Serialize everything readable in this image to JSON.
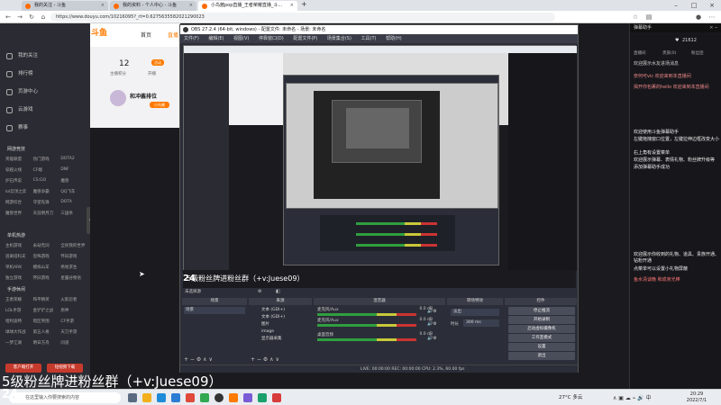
{
  "browser": {
    "tabs": [
      {
        "label": "我的关注 - 斗鱼"
      },
      {
        "label": "我的资料 - 个人中心 - 斗鱼"
      },
      {
        "label": "小鸟酱pop直播_王者荣耀直播_斗..."
      }
    ],
    "url": "https://www.douyu.com/10216095?_rt=0.6275635582021290023"
  },
  "douyu": {
    "logo": "斗鱼",
    "header_nav": [
      "首页",
      "直播"
    ],
    "left_nav": [
      {
        "label": "我的关注"
      },
      {
        "label": "排行榜"
      },
      {
        "label": "页游中心"
      },
      {
        "label": "云游戏"
      },
      {
        "label": "赛事"
      }
    ],
    "section_online": "网游竞技",
    "online_games": [
      "英雄联盟",
      "热门游戏",
      "DOTA2",
      "穿越火线",
      "CF端",
      "DNF",
      "炉石传说",
      "CS:GO",
      "魔兽",
      "lol云顶之弈",
      "魔兽争霸",
      "QQ飞车",
      "网游综合",
      "守望先锋",
      "DOTA",
      "魔兽世界",
      "天涯明月刀",
      "三国杀"
    ],
    "section_mobile": "单机热游",
    "mobile_games": [
      "主机游戏",
      "永劫无间",
      "全民我的世界",
      "逃离塔科夫",
      "恐怖游戏",
      "怀旧游戏",
      "单机ARK",
      "模拟山羊",
      "绝地求生",
      "独立游戏",
      "怀旧游戏",
      "星露谷物语"
    ],
    "section_hand": "手游休闲",
    "hand_games": [
      "王者荣耀",
      "和平精英",
      "火影忍者",
      "LOL手游",
      "金铲铲之战",
      "原神",
      "哈利波特",
      "暗区突围",
      "CF手游",
      "球球大作战",
      "第五人格",
      "天刀手游",
      "一梦江湖",
      "明日方舟",
      "问道"
    ],
    "stat_value": "12",
    "stat_label": "主播积分",
    "stat_label2": "开播",
    "badge": "活动",
    "room_title": "和冲酱排位",
    "room_sub": "小鸟酱",
    "left_buttons": [
      "客户端打开",
      "短视频下载"
    ],
    "overlay_text": "5级粉丝牌进粉丝群（+v:Juese09）",
    "overlay_prefix": "24"
  },
  "chat": {
    "title": "弹幕助手",
    "count": "21612",
    "tabs": [
      "直播间",
      "贵族(0)",
      "粉丝团"
    ],
    "lines": [
      "欢迎展示水友进场消息",
      "奈何可vic 欢迎来到本直播间",
      "揭开你包裹的hello 欢迎来到本直播间",
      "欢迎使用斗鱼弹幕助手",
      "左键拖拽窗口位置，左键拉伸边框改变大小",
      "右上角有设置菜单",
      "欢迎展示弹幕、表情礼物、粉丝牌升级等",
      "添加弹幕助手成功",
      "欢迎展示你收到的礼物、道具、贵族开通、钻粉开通",
      "点菜单可以设置小礼物屏蔽",
      "鱼水清谈晚 和成亲光棒"
    ]
  },
  "obs": {
    "title": "OBS 27.2.4 (64-bit, windows) - 配置文件: 未命名 - 场景: 未命名",
    "menu": [
      "文件(F)",
      "编辑(E)",
      "视图(V)",
      "停靠窗口(D)",
      "配置文件(P)",
      "场景集合(S)",
      "工具(T)",
      "帮助(H)"
    ],
    "source_bar_hint": "未选择源",
    "docks": {
      "scenes": {
        "title": "场景",
        "items": [
          "场景"
        ]
      },
      "sources": {
        "title": "来源",
        "items": [
          "文本 (GDI+)",
          "文本 (GDI+)",
          "图片",
          "image",
          "显示器采集"
        ]
      },
      "mixer": {
        "title": "混音器",
        "channels": [
          {
            "name": "麦克风/Aux",
            "level": "0.0 dB"
          },
          {
            "name": "麦克风/Aux",
            "level": "0.0 dB"
          },
          {
            "name": "桌面音频",
            "level": "0.0 dB"
          }
        ]
      },
      "transitions": {
        "title": "转场特效",
        "type": "淡出",
        "duration_label": "时长",
        "duration": "300 ms"
      },
      "controls": {
        "title": "控件",
        "buttons": [
          "停止推流",
          "开始录制",
          "启动虚拟摄像机",
          "工作室模式",
          "设置",
          "退出"
        ]
      }
    },
    "status": "LIVE: 00:00:00   REC: 00:00:00   CPU: 2.3%, 60.00 fps"
  },
  "taskbar": {
    "search_placeholder": "在这里输入你要搜索的内容",
    "weather": "27°C 多云",
    "time": "20:29",
    "date": "2022/7/1"
  },
  "colors": {
    "douyu_orange": "#ff7a00",
    "live_red": "#c63a2c"
  }
}
